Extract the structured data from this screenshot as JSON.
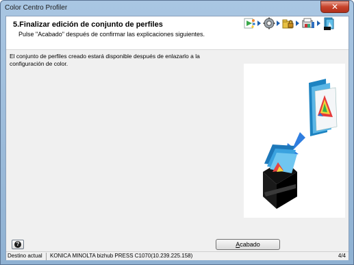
{
  "window": {
    "title": "Color Centro Profiler",
    "close_label": "✕"
  },
  "header": {
    "title": "5.Finalizar edición de conjunto de perfiles",
    "subtitle": "Pulse \"Acabado\" después de confirmar las explicaciones siguientes."
  },
  "steps": [
    {
      "icon": "media-play-icon"
    },
    {
      "icon": "gear-icon"
    },
    {
      "icon": "folder-lock-icon"
    },
    {
      "icon": "printer-profile-icon"
    },
    {
      "icon": "profile-set-icon"
    }
  ],
  "main": {
    "description": "El conjunto de perfiles creado estará disponible después de enlazarlo a la configuración de color."
  },
  "footer": {
    "help_label": "?",
    "finish_label_pre": "",
    "finish_label_underline": "A",
    "finish_label_post": "cabado"
  },
  "statusbar": {
    "label": "Destino actual",
    "device": "KONICA MINOLTA bizhub PRESS C1070(10.239.225.158)",
    "page": "4/4"
  },
  "colors": {
    "accent": "#1e5fae",
    "titlebar": "#a9c6e2",
    "close": "#c7432b"
  }
}
